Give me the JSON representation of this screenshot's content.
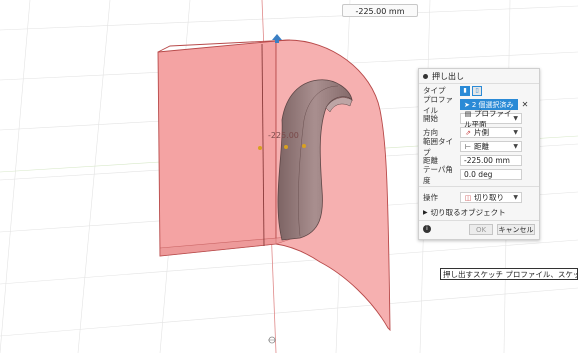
{
  "canvas": {
    "dimension_value": "-225.00 mm",
    "dimension_label": "-225.00"
  },
  "panel": {
    "title": "押し出し",
    "rows": {
      "type": {
        "label": "タイプ"
      },
      "profile": {
        "label": "プロファイル",
        "chip": "2 個選択済み",
        "clear": "✕"
      },
      "start": {
        "label": "開始",
        "value": "プロファイル平面"
      },
      "direction": {
        "label": "方向",
        "value": "片側"
      },
      "extent_type": {
        "label": "範囲タイプ",
        "value": "距離"
      },
      "distance": {
        "label": "距離",
        "value": "-225.00 mm"
      },
      "taper": {
        "label": "テーパ角度",
        "value": "0.0 deg"
      },
      "operation": {
        "label": "操作",
        "value": "切り取り"
      }
    },
    "objects_to_cut": "切り取るオブジェクト",
    "ok": "OK",
    "cancel": "キャンセル"
  },
  "tooltip": "押し出すスケッチ プロファイル、スケッチ曲線、また",
  "colors": {
    "surface": "#f4a3a3",
    "edge": "#b84a4a",
    "accent": "#2a8ad6",
    "handle": "#3a7fc4",
    "cut_solid": "#9c8080"
  }
}
